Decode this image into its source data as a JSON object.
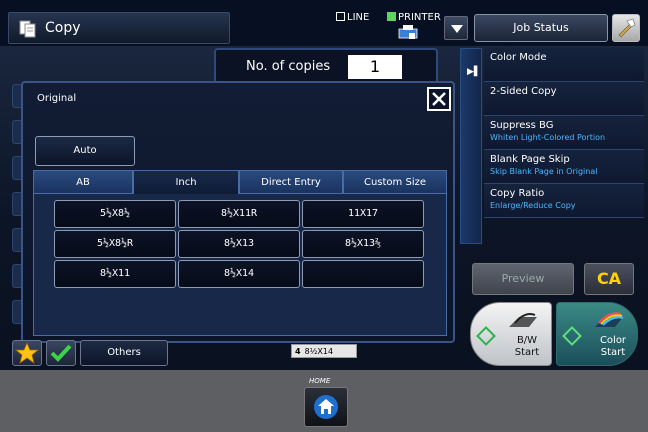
{
  "header": {
    "mode": "Copy",
    "line_label": "LINE",
    "printer_label": "PRINTER",
    "job_status": "Job Status"
  },
  "copies": {
    "label": "No. of copies",
    "value": "1"
  },
  "right_panel": {
    "items": [
      {
        "main": "Color Mode",
        "sub": ""
      },
      {
        "main": "2-Sided Copy",
        "sub": ""
      },
      {
        "main": "Suppress BG",
        "sub": "Whiten Light-Colored Portion"
      },
      {
        "main": "Blank Page Skip",
        "sub": "Skip Blank Page in Original"
      },
      {
        "main": "Copy Ratio",
        "sub": "Enlarge/Reduce Copy"
      }
    ]
  },
  "preview": "Preview",
  "ca": "CA",
  "bw_start": {
    "line1": "B/W",
    "line2": "Start"
  },
  "color_start": {
    "line1": "Color",
    "line2": "Start"
  },
  "dialog": {
    "title": "Original",
    "auto": "Auto",
    "tabs": [
      "AB",
      "Inch",
      "Direct Entry",
      "Custom Size"
    ],
    "active_tab": "Inch",
    "sizes": [
      "5½X8½",
      "8½X11R",
      "11X17",
      "5½X8½R",
      "8½X13",
      "8½X13⅖",
      "8½X11",
      "8½X14",
      ""
    ]
  },
  "others": "Others",
  "tray": {
    "num": "4",
    "size": "8½X14"
  },
  "home_label": "HOME",
  "colors": {
    "accent_blue": "#4db6ff",
    "ca_yellow": "#ffd200",
    "start_green": "#29b34a"
  }
}
